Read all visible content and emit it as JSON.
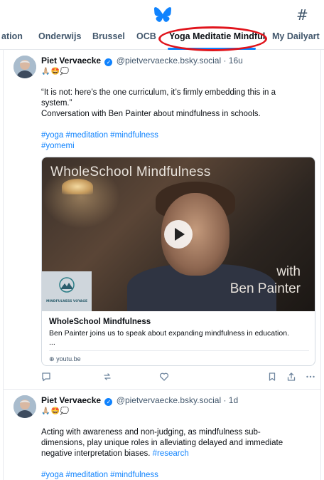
{
  "app": {
    "brand_color": "#1083fe",
    "logo_icon": "butterfly-icon",
    "feeds_icon": "hash-icon",
    "hash_glyph": "#"
  },
  "tabs": [
    {
      "label": "ation",
      "active": false
    },
    {
      "label": "Onderwijs",
      "active": false
    },
    {
      "label": "Brussel",
      "active": false
    },
    {
      "label": "OCB",
      "active": false
    },
    {
      "label": "Yoga Meditatie Mindful",
      "active": true
    },
    {
      "label": "My Dailyart",
      "active": false
    }
  ],
  "posts": [
    {
      "author": "Piet Vervaecke",
      "handle": "@pietvervaecke.bsky.social",
      "time": "· 16u",
      "emojis": "🙏🏼🤩💭",
      "line1": "“It is not: here’s the one curriculum, it’s firmly embedding this in a",
      "line2": "system.”",
      "line3": "Conversation with Ben Painter about mindfulness in schools.",
      "tags1": "#yoga #meditation #mindfulness",
      "tags2": "#yomemi",
      "embed": {
        "thumb_title": "WholeSchool Mindfulness",
        "thumb_with": "with",
        "thumb_name": "Ben Painter",
        "channel_text": "MINDFULNESS VOYAGE",
        "title": "WholeSchool Mindfulness",
        "description": "Ben Painter joins us to speak about expanding mindfulness in education.",
        "ellipsis": "...",
        "domain": "youtu.be"
      }
    },
    {
      "author": "Piet Vervaecke",
      "handle": "@pietvervaecke.bsky.social",
      "time": "· 1d",
      "emojis": "🙏🏼🤩💭",
      "line1": "Acting with awareness and non-judging, as mindfulness sub-",
      "line2": "dimensions, play unique roles in alleviating delayed and immediate",
      "line3": "negative interpretation biases.",
      "line3_link": "#research",
      "tags1": "#yoga #meditation #mindfulness"
    }
  ]
}
